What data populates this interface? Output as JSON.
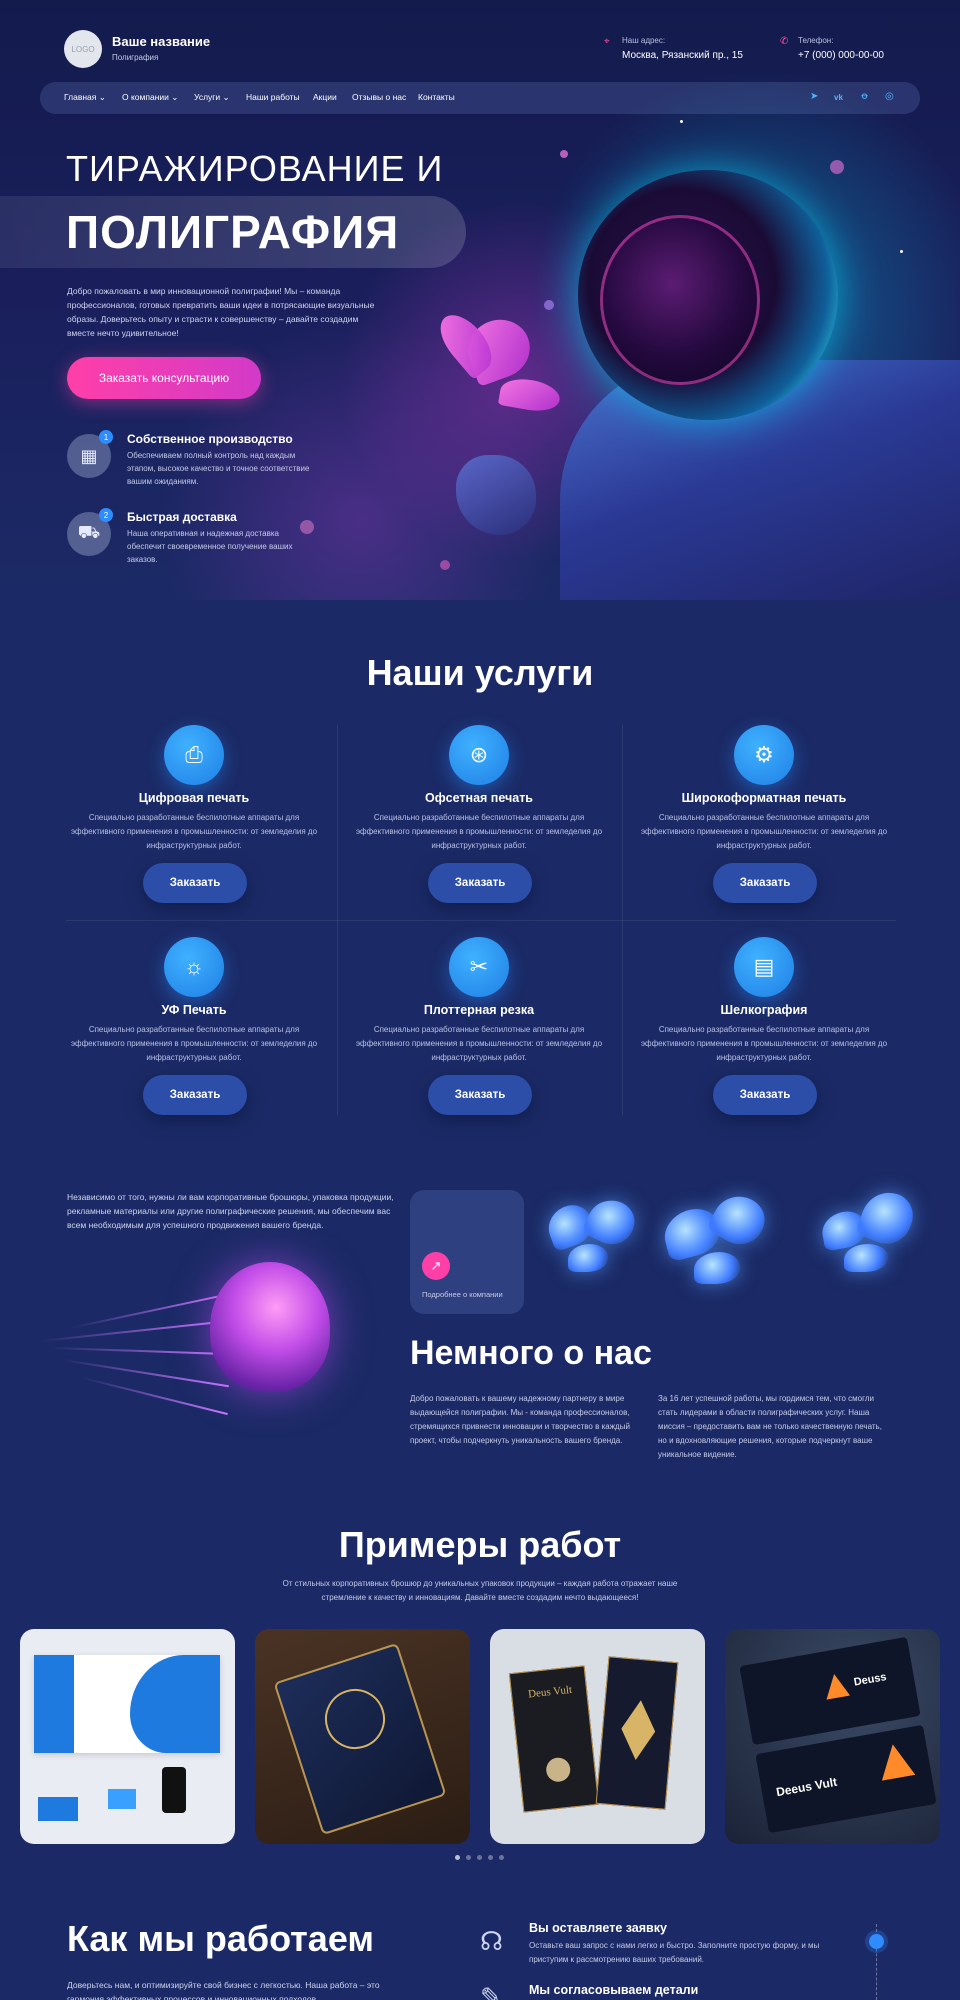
{
  "header": {
    "logo_text": "LOGO",
    "brand_name": "Ваше название",
    "brand_sub": "Полиграфия",
    "address_label": "Наш адрес:",
    "address_value": "Москва, Рязанский пр., 15",
    "phone_label": "Телефон:",
    "phone_value": "+7 (000) 000-00-00"
  },
  "nav": {
    "items": [
      "Главная",
      "О компании",
      "Услуги",
      "Наши работы",
      "Акции",
      "Отзывы о нас",
      "Контакты"
    ],
    "social_icons": [
      "telegram-icon",
      "vk-icon",
      "odnoklassniki-icon",
      "whatsapp-icon"
    ]
  },
  "hero": {
    "title_line1": "ТИРАЖИРОВАНИЕ И",
    "title_line2": "ПОЛИГРАФИЯ",
    "text": "Добро пожаловать в мир инновационной полиграфии! Мы – команда профессионалов, готовых превратить ваши идеи в потрясающие визуальные образы. Доверьтесь опыту и страсти к совершенству – давайте создадим вместе нечто удивительное!",
    "cta": "Заказать консультацию",
    "features": [
      {
        "num": "1",
        "title": "Собственное производство",
        "text": "Обеспечиваем полный контроль над каждым этапом, высокое качество и точное соответствие вашим ожиданиям."
      },
      {
        "num": "2",
        "title": "Быстрая доставка",
        "text": "Наша оперативная и надежная доставка обеспечит своевременное получение ваших заказов."
      }
    ]
  },
  "services": {
    "title": "Наши услуги",
    "button_label": "Заказать",
    "items": [
      {
        "title": "Цифровая печать",
        "icon": "print-icon",
        "text": "Специально разработанные беспилотные аппараты для эффективного применения в промышленности: от земледелия до инфраструктурных работ."
      },
      {
        "title": "Офсетная печать",
        "icon": "color-circles-icon",
        "text": "Специально разработанные беспилотные аппараты для эффективного применения в промышленности: от земледелия до инфраструктурных работ."
      },
      {
        "title": "Широкоформатная печать",
        "icon": "wide-format-printer-icon",
        "text": "Специально разработанные беспилотные аппараты для эффективного применения в промышленности: от земледелия до инфраструктурных работ."
      },
      {
        "title": "УФ Печать",
        "icon": "uv-printer-icon",
        "text": "Специально разработанные беспилотные аппараты для эффективного применения в промышленности: от земледелия до инфраструктурных работ."
      },
      {
        "title": "Плоттерная резка",
        "icon": "plotter-icon",
        "text": "Специально разработанные беспилотные аппараты для эффективного применения в промышленности: от земледелия до инфраструктурных работ."
      },
      {
        "title": "Шелкография",
        "icon": "silkscreen-roll-icon",
        "text": "Специально разработанные беспилотные аппараты для эффективного применения в промышленности: от земледелия до инфраструктурных работ."
      }
    ]
  },
  "about": {
    "intro": "Независимо от того, нужны ли вам корпоративные брошюры, упаковка продукции, рекламные материалы или другие полиграфические решения, мы обеспечим вас всем необходимым для успешного продвижения вашего бренда.",
    "card_link": "Подробнее о компании",
    "title": "Немного о нас",
    "col1": "Добро пожаловать к вашему надежному партнеру в мире выдающейся полиграфии. Мы - команда профессионалов, стремящихся привнести инновации и творчество в каждый проект, чтобы подчеркнуть уникальность вашего бренда.",
    "col2": "За 16 лет успешной работы, мы гордимся тем, что смогли стать лидерами в области полиграфических услуг. Наша миссия – предоставить вам не только качественную печать, но и вдохновляющие решения, которые подчеркнут ваше уникальное видение."
  },
  "portfolio": {
    "title": "Примеры работ",
    "subtitle": "От стильных корпоративных брошюр до уникальных упаковок продукции – каждая работа отражает наше стремление к качеству и инновациям. Давайте вместе создадим нечто выдающееся!",
    "cards": [
      {
        "kind": "stationery"
      },
      {
        "kind": "gold-cards"
      },
      {
        "kind": "deus-vult-brochures",
        "text": "Deus Vult"
      },
      {
        "kind": "deuss-business-cards",
        "text1": "Deuss",
        "text2": "Deeus Vult"
      }
    ],
    "active_dot": 0,
    "dot_count": 5
  },
  "how": {
    "title": "Как мы работаем",
    "text": "Доверьтесь нам, и оптимизируйте свой бизнес с легкостью. Наша работа – это гармония эффективных процессов и инновационных подходов.",
    "steps": [
      {
        "icon": "headset-icon",
        "title": "Вы оставляете заявку",
        "text": "Оставьте ваш запрос с нами легко и быстро. Заполните простую форму, и мы приступим к рассмотрению ваших требований."
      },
      {
        "icon": "agreement-icon",
        "title": "Мы согласовываем детали",
        "text": ""
      }
    ]
  },
  "colors": {
    "background": "#1b2a66",
    "accent_pink": "#ff3fa8",
    "accent_blue": "#2f8cff",
    "button_blue": "#2c4ea8"
  }
}
